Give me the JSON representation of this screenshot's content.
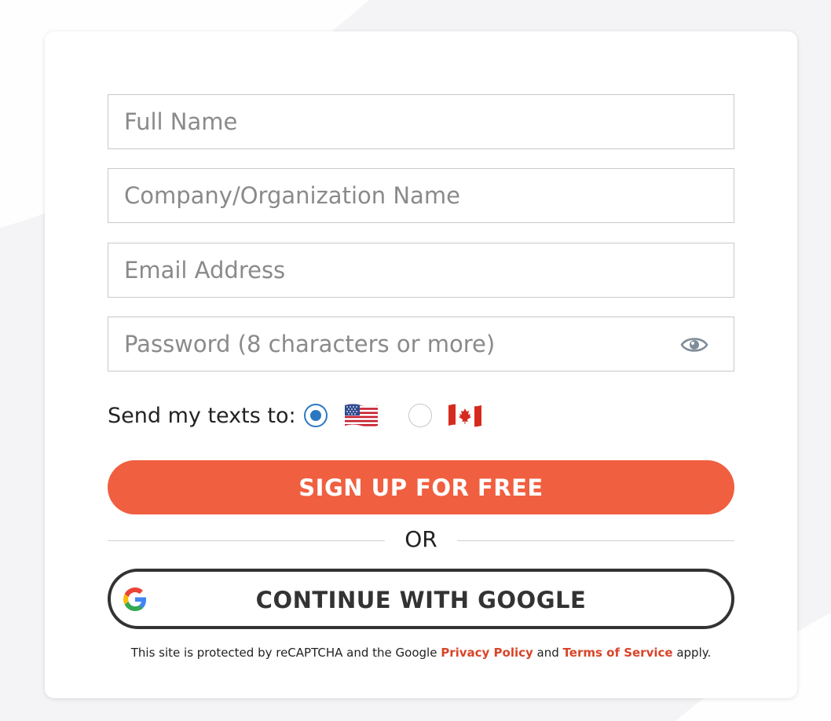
{
  "form": {
    "full_name_placeholder": "Full Name",
    "company_placeholder": "Company/Organization Name",
    "email_placeholder": "Email Address",
    "password_placeholder": "Password (8 characters or more)",
    "password_toggle_icon": "eye-icon"
  },
  "texts": {
    "label": "Send my texts to:",
    "options": [
      {
        "country": "us",
        "icon": "us-flag-icon",
        "selected": true
      },
      {
        "country": "ca",
        "icon": "canada-flag-icon",
        "selected": false
      }
    ]
  },
  "signup": {
    "label": "SIGN UP FOR FREE",
    "color": "#f05f40"
  },
  "divider": {
    "label": "OR"
  },
  "google": {
    "label": "CONTINUE WITH GOOGLE",
    "icon": "google-g-icon"
  },
  "legal": {
    "prefix": "This site is protected by reCAPTCHA and the Google ",
    "privacy_link": "Privacy Policy",
    "middle": " and ",
    "terms_link": "Terms of Service",
    "suffix": " apply.",
    "link_color": "#d8452a"
  }
}
